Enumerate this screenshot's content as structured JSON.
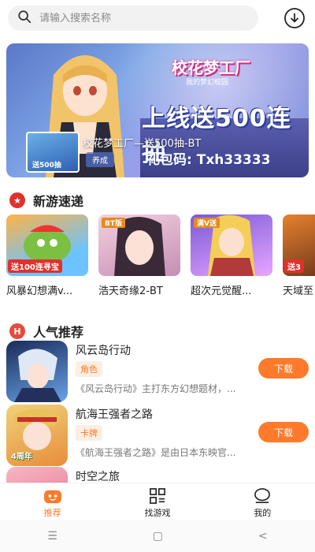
{
  "search": {
    "placeholder": "请输入搜索名称"
  },
  "banner": {
    "game_logo": "校花梦工厂",
    "game_logo_sub": "我的梦幻校园",
    "promo_line": "上线送500连抽",
    "promo_code": "礼包码: Txh33333",
    "thumb_label": "送500抽",
    "caption": "校花梦工厂—送500抽-BT",
    "tag": "养成"
  },
  "sections": {
    "new_games_title": "新游速递",
    "hot_title": "人气推荐"
  },
  "new_games": [
    {
      "name": "风暴幻想满v...",
      "ribbon": "送100连寻宝",
      "corner": ""
    },
    {
      "name": "浩天奇缘2-BT",
      "ribbon": "",
      "corner": "BT版"
    },
    {
      "name": "超次元觉醒...",
      "ribbon": "",
      "corner": "满V送"
    },
    {
      "name": "天域至",
      "ribbon": "送3",
      "corner": ""
    }
  ],
  "hot_list": [
    {
      "title": "风云岛行动",
      "genre": "角色",
      "desc": "《风云岛行动》主打东方幻想题材，...",
      "button": "下载"
    },
    {
      "title": "航海王强者之路",
      "genre": "卡牌",
      "desc": "《航海王强者之路》是由日本东映官...",
      "button": "下载",
      "icon_label": "4周年"
    },
    {
      "title": "时空之旅",
      "genre": "",
      "desc": "",
      "button": ""
    }
  ],
  "tabbar": [
    {
      "label": "推荐",
      "active": true
    },
    {
      "label": "找游戏",
      "active": false
    },
    {
      "label": "我的",
      "active": false
    }
  ],
  "colors": {
    "accent": "#ff7a2a",
    "new_badge": "#e0312d",
    "hot_badge": "#e64a3c"
  }
}
